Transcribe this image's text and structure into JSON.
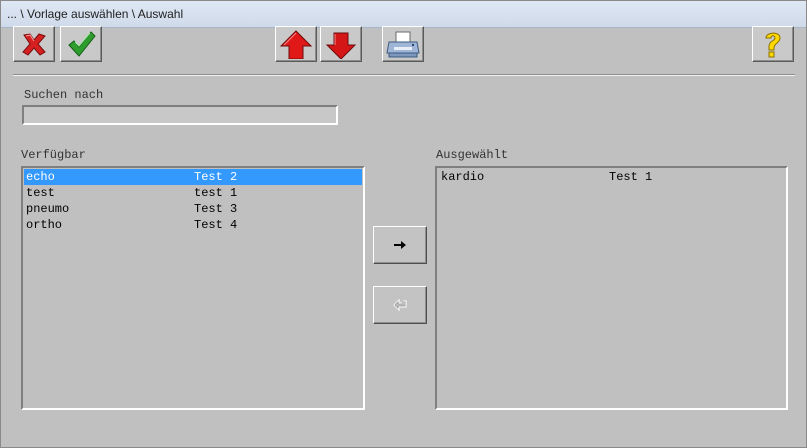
{
  "window": {
    "title": "... \\ Vorlage auswählen \\ Auswahl"
  },
  "toolbar": {
    "buttons": [
      {
        "name": "cancel",
        "icon": "red-x-icon"
      },
      {
        "name": "ok",
        "icon": "green-check-icon"
      },
      {
        "name": "move-up",
        "icon": "red-up-arrow-icon"
      },
      {
        "name": "move-down",
        "icon": "red-down-arrow-icon"
      },
      {
        "name": "print",
        "icon": "printer-icon"
      },
      {
        "name": "help",
        "icon": "yellow-question-icon"
      }
    ]
  },
  "search": {
    "label": "Suchen nach",
    "value": ""
  },
  "available": {
    "label": "Verfügbar",
    "items": [
      {
        "code": "echo",
        "name": "Test 2",
        "selected": true
      },
      {
        "code": "test",
        "name": "test 1",
        "selected": false
      },
      {
        "code": "pneumo",
        "name": "Test 3",
        "selected": false
      },
      {
        "code": "ortho",
        "name": "Test 4",
        "selected": false
      }
    ]
  },
  "selected_list": {
    "label": "Ausgewählt",
    "items": [
      {
        "code": "kardio",
        "name": "Test 1"
      }
    ]
  },
  "transfer": {
    "add_icon": "arrow-right-icon",
    "remove_icon": "arrow-left-disabled-icon",
    "remove_enabled": false
  },
  "colors": {
    "background": "#c0c0c0",
    "selection": "#3399ff",
    "danger": "#d42020",
    "success": "#2e9d2e",
    "help": "#ffd800"
  }
}
